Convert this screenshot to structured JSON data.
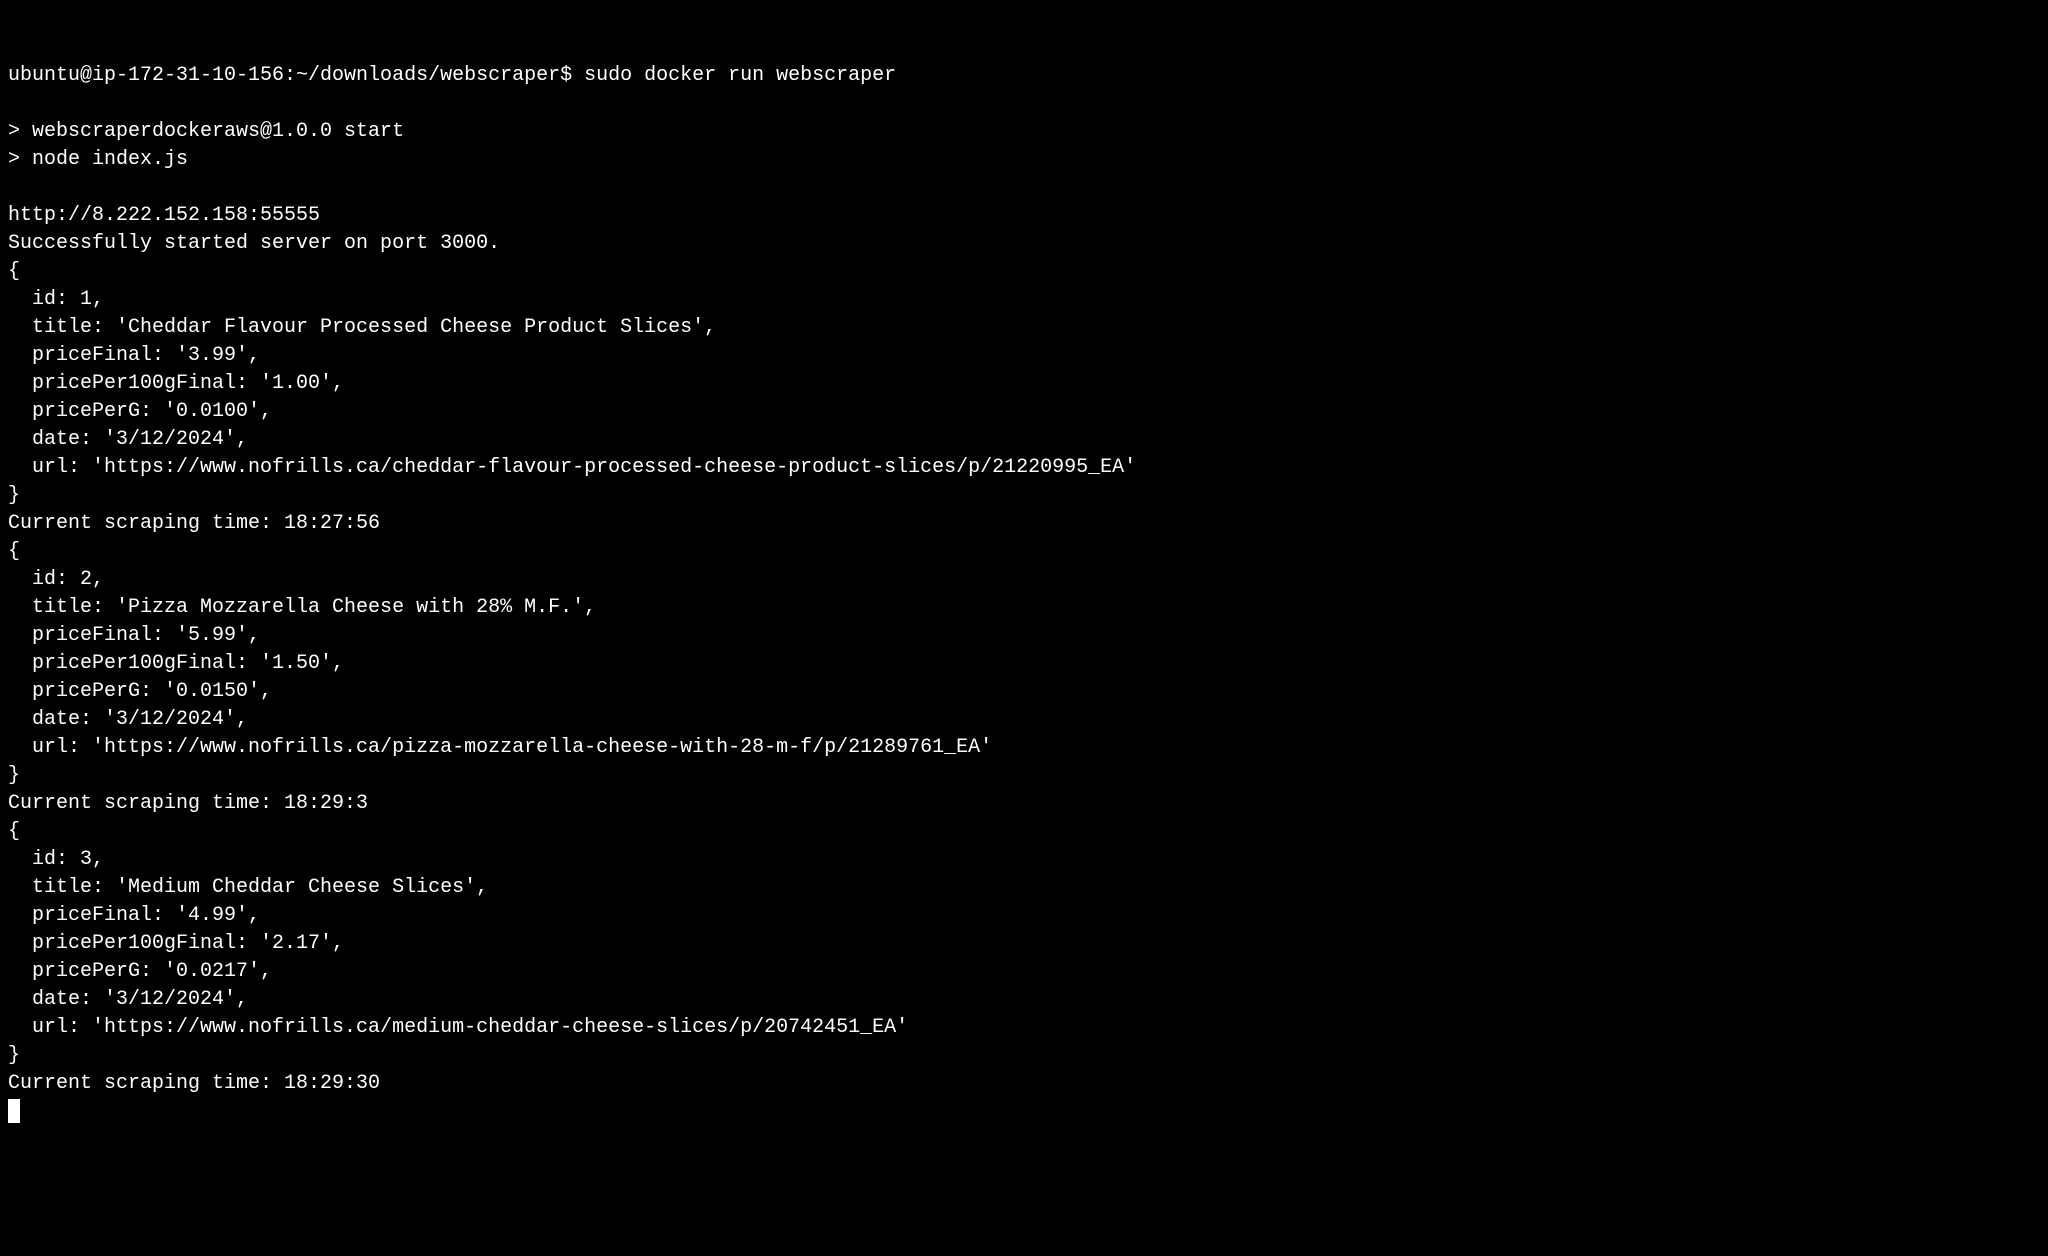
{
  "prompt": {
    "user_host_path": "ubuntu@ip-172-31-10-156:~/downloads/webscraper$ ",
    "command": "sudo docker run webscraper"
  },
  "npm_start": {
    "line1": "> webscraperdockeraws@1.0.0 start",
    "line2": "> node index.js"
  },
  "server": {
    "url": "http://8.222.152.158:55555",
    "started": "Successfully started server on port 3000."
  },
  "records": [
    {
      "open": "{",
      "id": "  id: 1,",
      "title": "  title: 'Cheddar Flavour Processed Cheese Product Slices',",
      "priceFinal": "  priceFinal: '3.99',",
      "pricePer100g": "  pricePer100gFinal: '1.00',",
      "pricePerG": "  pricePerG: '0.0100',",
      "date": "  date: '3/12/2024',",
      "url": "  url: 'https://www.nofrills.ca/cheddar-flavour-processed-cheese-product-slices/p/21220995_EA'",
      "close": "}",
      "scrape_time": "Current scraping time: 18:27:56"
    },
    {
      "open": "{",
      "id": "  id: 2,",
      "title": "  title: 'Pizza Mozzarella Cheese with 28% M.F.',",
      "priceFinal": "  priceFinal: '5.99',",
      "pricePer100g": "  pricePer100gFinal: '1.50',",
      "pricePerG": "  pricePerG: '0.0150',",
      "date": "  date: '3/12/2024',",
      "url": "  url: 'https://www.nofrills.ca/pizza-mozzarella-cheese-with-28-m-f/p/21289761_EA'",
      "close": "}",
      "scrape_time": "Current scraping time: 18:29:3"
    },
    {
      "open": "{",
      "id": "  id: 3,",
      "title": "  title: 'Medium Cheddar Cheese Slices',",
      "priceFinal": "  priceFinal: '4.99',",
      "pricePer100g": "  pricePer100gFinal: '2.17',",
      "pricePerG": "  pricePerG: '0.0217',",
      "date": "  date: '3/12/2024',",
      "url": "  url: 'https://www.nofrills.ca/medium-cheddar-cheese-slices/p/20742451_EA'",
      "close": "}",
      "scrape_time": "Current scraping time: 18:29:30"
    }
  ]
}
